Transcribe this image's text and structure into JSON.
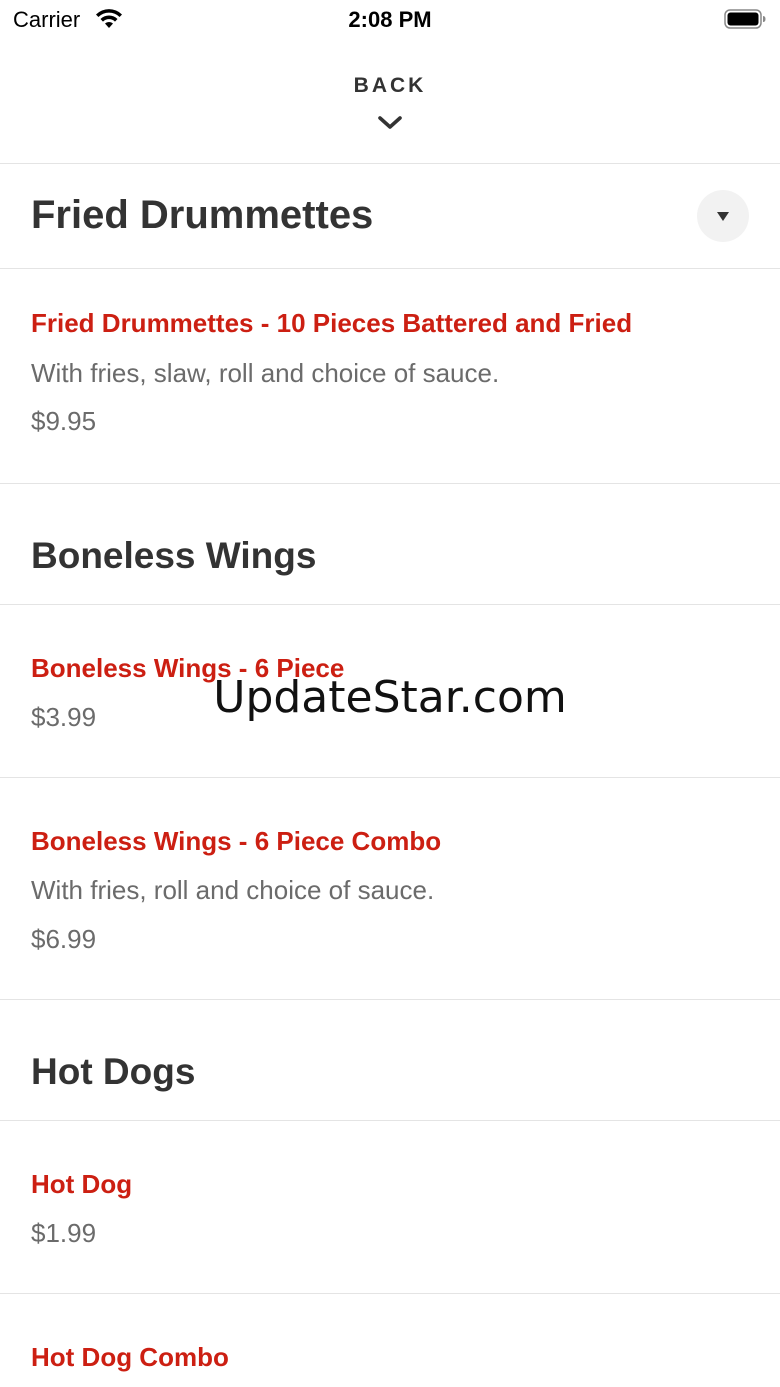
{
  "status_bar": {
    "carrier": "Carrier",
    "time": "2:08 PM",
    "wifi_icon": "wifi-icon",
    "battery_icon": "battery-icon"
  },
  "header": {
    "back_label": "BACK",
    "chevron_icon": "chevron-down-icon"
  },
  "sections": [
    {
      "title": "Fried Drummettes",
      "dropdown_icon": "triangle-down-icon",
      "items": [
        {
          "name": "Fried Drummettes - 10 Pieces Battered and Fried",
          "description": "With fries, slaw, roll and choice of sauce.",
          "price": "$9.95"
        }
      ]
    },
    {
      "title": "Boneless Wings",
      "items": [
        {
          "name": "Boneless Wings - 6 Piece",
          "price": "$3.99"
        },
        {
          "name": "Boneless Wings - 6 Piece Combo",
          "description": "With fries, roll and choice of sauce.",
          "price": "$6.99"
        }
      ]
    },
    {
      "title": "Hot Dogs",
      "items": [
        {
          "name": "Hot Dog",
          "price": "$1.99"
        },
        {
          "name": "Hot Dog Combo"
        }
      ]
    }
  ],
  "watermark": "UpdateStar.com",
  "colors": {
    "item_name": "#cc1f12",
    "title": "#333333",
    "secondary_text": "#6b6b6b",
    "divider": "#e4e4e4"
  }
}
